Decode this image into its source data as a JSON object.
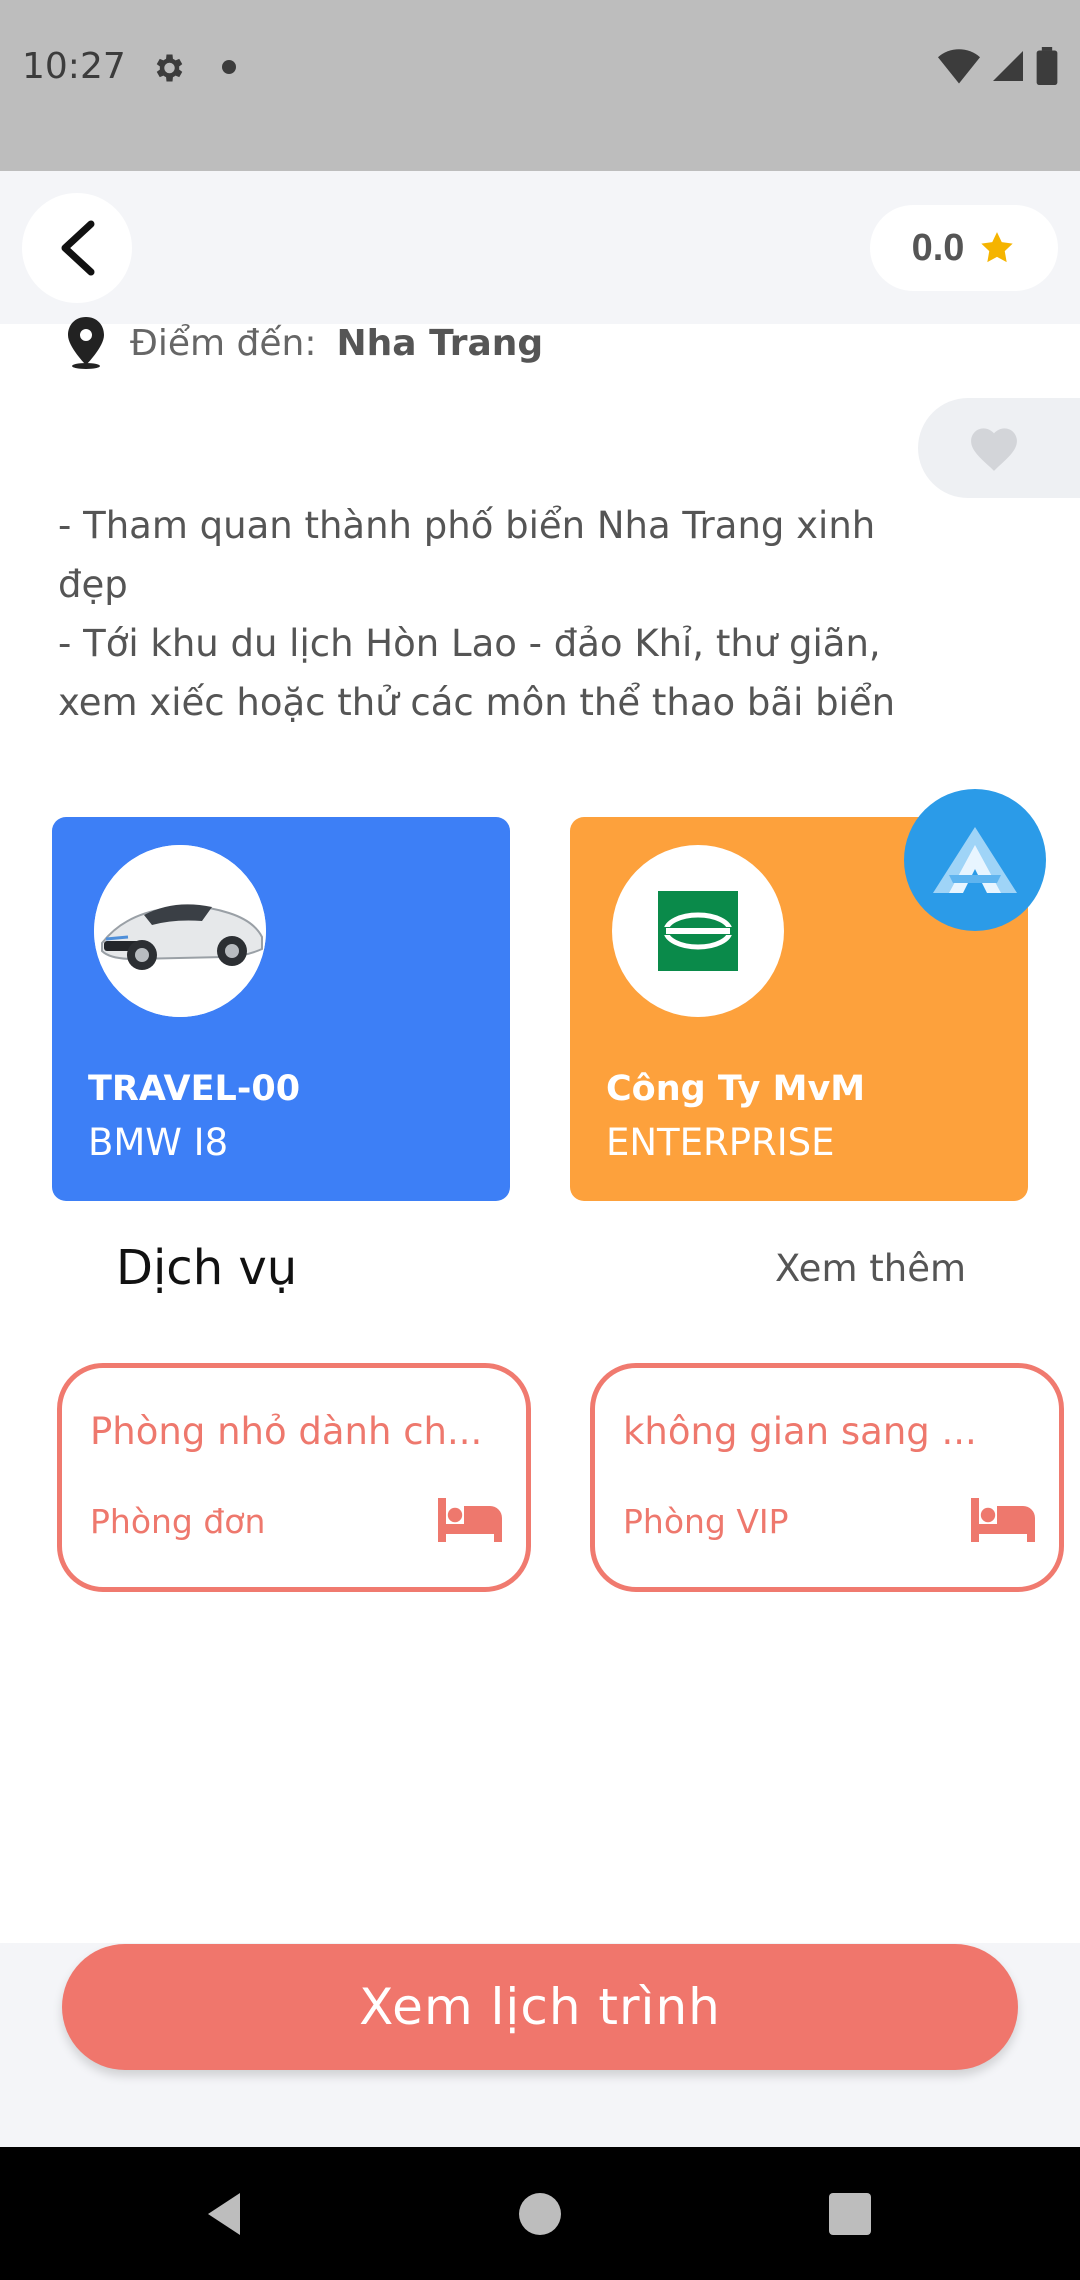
{
  "status_bar": {
    "time": "10:27"
  },
  "header": {
    "rating": "0.0"
  },
  "destination": {
    "label": "Điểm đến:",
    "value": "Nha Trang"
  },
  "description": "- Tham quan thành phố biển Nha Trang xinh\nđẹp\n- Tới khu du lịch Hòn Lao - đảo Khỉ, thư giãn,\nxem xiếc hoặc thử các môn thể thao bãi biển",
  "cards": [
    {
      "title": "TRAVEL-00",
      "subtitle": "BMW I8",
      "color": "#3d7ff6"
    },
    {
      "title": "Công Ty MvM",
      "subtitle": "ENTERPRISE",
      "color": "#fda13c"
    }
  ],
  "services_section": {
    "title": "Dịch vụ",
    "see_more": "Xem thêm"
  },
  "services": [
    {
      "title": "Phòng nhỏ dành ch...",
      "type": "Phòng đơn"
    },
    {
      "title": "không gian sang ...",
      "type": "Phòng VIP"
    }
  ],
  "cta": {
    "label": "Xem lịch trình"
  },
  "colors": {
    "accent": "#f0766c",
    "star": "#f5b400",
    "badge": "#2b9be8"
  },
  "icons": [
    "back-arrow-icon",
    "star-icon",
    "location-pin-icon",
    "heart-icon",
    "bed-icon",
    "gear-icon",
    "wifi-icon",
    "signal-icon",
    "battery-icon"
  ]
}
